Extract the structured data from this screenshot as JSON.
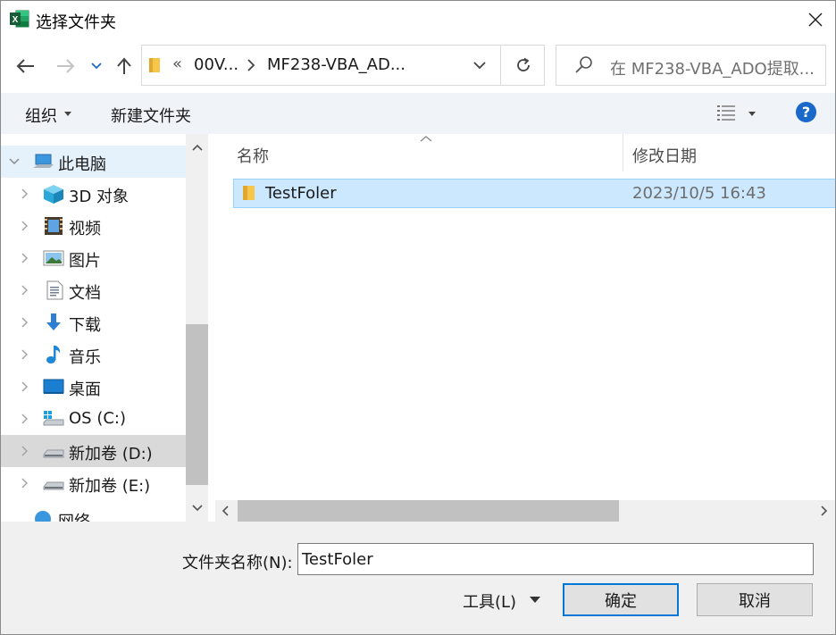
{
  "window": {
    "title": "选择文件夹",
    "app_icon": "excel-icon"
  },
  "nav": {
    "breadcrumb_overflow": "«",
    "breadcrumb": [
      "00V...",
      "MF238-VBA_AD..."
    ],
    "search_placeholder": "在 MF238-VBA_ADO提取..."
  },
  "command_bar": {
    "organize_label": "组织",
    "new_folder_label": "新建文件夹",
    "help_label": "?"
  },
  "tree": {
    "items": [
      {
        "label": "此电脑",
        "icon": "computer-icon",
        "expanded": true
      },
      {
        "label": "3D 对象",
        "icon": "3d-objects-icon"
      },
      {
        "label": "视频",
        "icon": "video-icon"
      },
      {
        "label": "图片",
        "icon": "pictures-icon"
      },
      {
        "label": "文档",
        "icon": "documents-icon"
      },
      {
        "label": "下载",
        "icon": "download-icon"
      },
      {
        "label": "音乐",
        "icon": "music-icon"
      },
      {
        "label": "桌面",
        "icon": "desktop-icon"
      },
      {
        "label": "OS (C:)",
        "icon": "os-drive-icon"
      },
      {
        "label": "新加卷 (D:)",
        "icon": "drive-icon",
        "selected": true
      },
      {
        "label": "新加卷 (E:)",
        "icon": "drive-icon"
      },
      {
        "label": "网络",
        "icon": "network-icon"
      }
    ]
  },
  "list": {
    "columns": [
      "名称",
      "修改日期"
    ],
    "rows": [
      {
        "name": "TestFoler",
        "modified": "2023/10/5 16:43",
        "icon": "folder-icon"
      }
    ]
  },
  "footer": {
    "folder_name_label": "文件夹名称(N):",
    "folder_name_value": "TestFoler",
    "tools_label": "工具(L)",
    "ok_label": "确定",
    "cancel_label": "取消"
  },
  "colors": {
    "selection": "#cce8ff",
    "nav_highlight": "#e5f1fb",
    "accent": "#0078d7",
    "help": "#1a68c9"
  }
}
